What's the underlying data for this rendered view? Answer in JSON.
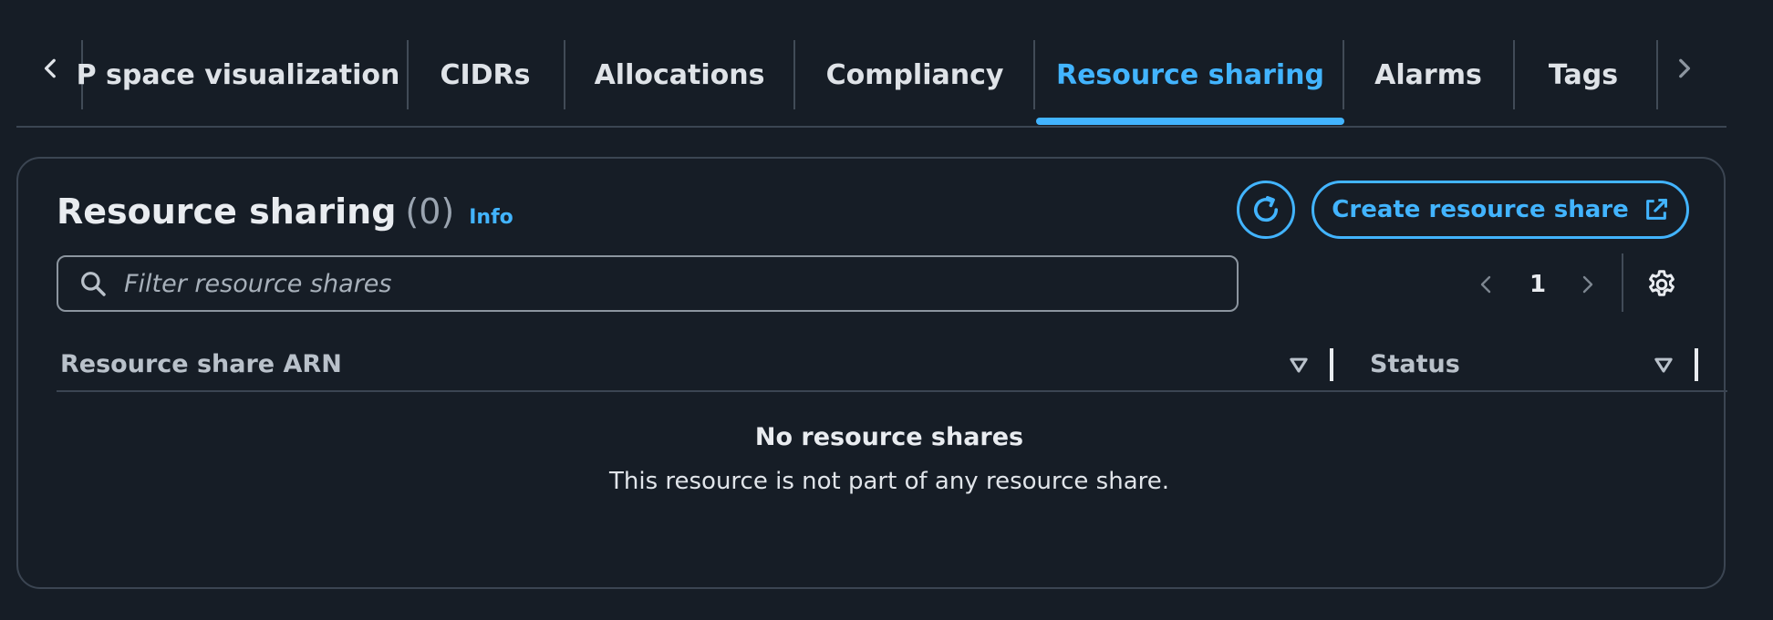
{
  "tabs": [
    {
      "label": "P space visualization",
      "active": false
    },
    {
      "label": "CIDRs",
      "active": false
    },
    {
      "label": "Allocations",
      "active": false
    },
    {
      "label": "Compliancy",
      "active": false
    },
    {
      "label": "Resource sharing",
      "active": true
    },
    {
      "label": "Alarms",
      "active": false
    },
    {
      "label": "Tags",
      "active": false
    }
  ],
  "panel": {
    "title": "Resource sharing",
    "count": "(0)",
    "info_label": "Info",
    "create_button_label": "Create resource share"
  },
  "search": {
    "placeholder": "Filter resource shares",
    "value": ""
  },
  "pagination": {
    "current_page": "1"
  },
  "table": {
    "columns": [
      {
        "label": "Resource share ARN"
      },
      {
        "label": "Status"
      }
    ],
    "rows": []
  },
  "empty_state": {
    "title": "No resource shares",
    "description": "This resource is not part of any resource share."
  },
  "colors": {
    "background": "#161d26",
    "accent": "#42b4ff",
    "text": "#dfe3e8",
    "border": "#3b4552"
  },
  "icons": {
    "tab_prev": "chevron-left-icon",
    "tab_next": "chevron-right-icon",
    "refresh": "refresh-icon",
    "external": "external-link-icon",
    "search": "search-icon",
    "settings": "gear-icon",
    "sort": "sort-caret-down-icon"
  }
}
